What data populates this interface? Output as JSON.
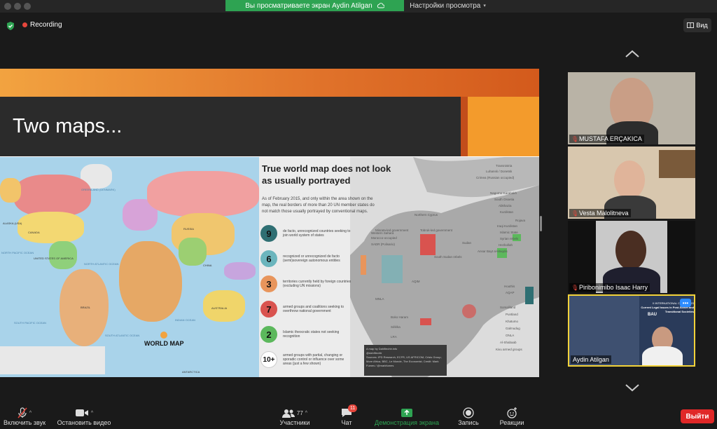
{
  "window": {
    "banner_text": "Вы просматриваете экран Aydin Atilgan",
    "view_settings": "Настройки просмотра",
    "recording_label": "Recording",
    "view_button": "Вид"
  },
  "slide": {
    "title": "Two maps...",
    "world_map_title": "WORLD MAP",
    "map_labels": [
      "GREENLAND (DENMARK)",
      "CANADA",
      "ALASKA (USA)",
      "UNITED STATES OF AMERICA",
      "RUSSIA",
      "CHINA",
      "BRAZIL",
      "AUSTRALIA",
      "NORTH PACIFIC OCEAN",
      "NORTH ATLANTIC OCEAN",
      "SOUTH PACIFIC OCEAN",
      "SOUTH ATLANTIC OCEAN",
      "INDIAN OCEAN",
      "ANTARCTICA"
    ],
    "infographic": {
      "heading": "True world map does not look as usually portrayed",
      "intro": "As of February 2015, and only within the area shown on the map, the real borders of more than 20 UN member states do not match those usually portrayed by conventional maps.",
      "legend": [
        {
          "num": "9",
          "text": "de facto, unrecognized countries seeking to join world system of states",
          "color": "#2f6f73"
        },
        {
          "num": "6",
          "text": "recognized or unrecognized de facto (semi)sovereign autonomous entities",
          "color": "#6bb5bd"
        },
        {
          "num": "3",
          "text": "territories currently held by foreign countries (excluding UN missions)",
          "color": "#e8955c"
        },
        {
          "num": "7",
          "text": "armed groups and coalitions seeking to overthrow national government",
          "color": "#d9534f"
        },
        {
          "num": "2",
          "text": "Islamic theocratic states not seeking recognition",
          "color": "#5cb85c"
        },
        {
          "num": "10+",
          "text": "armed groups with partial, changing or sporadic control or influence over some areas (just a few shown)",
          "color": "#ffffff"
        }
      ],
      "right_labels": [
        "Transnistria",
        "Luhansk / Donetsk",
        "Crimea (Russian occupied)",
        "Nagorno-Karabakh",
        "South Ossetia",
        "Abkhazia",
        "Kurdistan",
        "Rojava",
        "Iraqi Kurdistan",
        "Islamic State",
        "Syrian rebels",
        "Hezbollah",
        "Ansar Bayt al-Maqdis",
        "Houthis",
        "AQAP",
        "Somaliland",
        "Puntland",
        "Khatumo",
        "Galmudug",
        "ONLA",
        "Al-Shabaab",
        "Kivu armed groups"
      ],
      "left_labels": [
        "Northern Cyprus",
        "Western Sahara",
        "Morocco-occupied",
        "SADR (Polisario)",
        "Misrata-led government",
        "Tobruk-led government",
        "MNLA",
        "AQIM",
        "Boko Haram",
        "Séléka",
        "Sudan",
        "South Sudan rebels",
        "LRA"
      ],
      "credits_title": "A map by Dahlfiechtr.info",
      "credits_handle": "@dahlfiechtr",
      "credits_sources": "Sources: IPD Research, ECFR, US AFRICOM, Crisis Group; More Africa, BBC, Le Monde, The Economist; Credit: Mark Fumes / @markfumes"
    }
  },
  "participants": [
    {
      "name": "MUSTAFA ERÇAKICA",
      "muted": true
    },
    {
      "name": "Vesta Malolitneva",
      "muted": true
    },
    {
      "name": "Piribonimibo Isaac Harry",
      "muted": true
    },
    {
      "name": "Aydin Atilgan",
      "muted": false,
      "active": true
    }
  ],
  "active_share_overlay": {
    "line1": "X INTERNATIONAL CONGRESS",
    "line2": "Current Legal Issues in Post-Soviet and Transitional Societies",
    "logo": "BAU"
  },
  "toolbar": {
    "mute": "Включить звук",
    "video": "Остановить видео",
    "participants": "Участники",
    "participants_count": "77",
    "chat": "Чат",
    "chat_badge": "11",
    "share": "Демонстрация экрана",
    "record": "Запись",
    "reactions": "Реакции",
    "leave": "Выйти"
  },
  "colors": {
    "share_green": "#2ea352",
    "leave_red": "#e02828",
    "active_border": "#f2d23a",
    "slide_orange": "#f39b2c"
  }
}
